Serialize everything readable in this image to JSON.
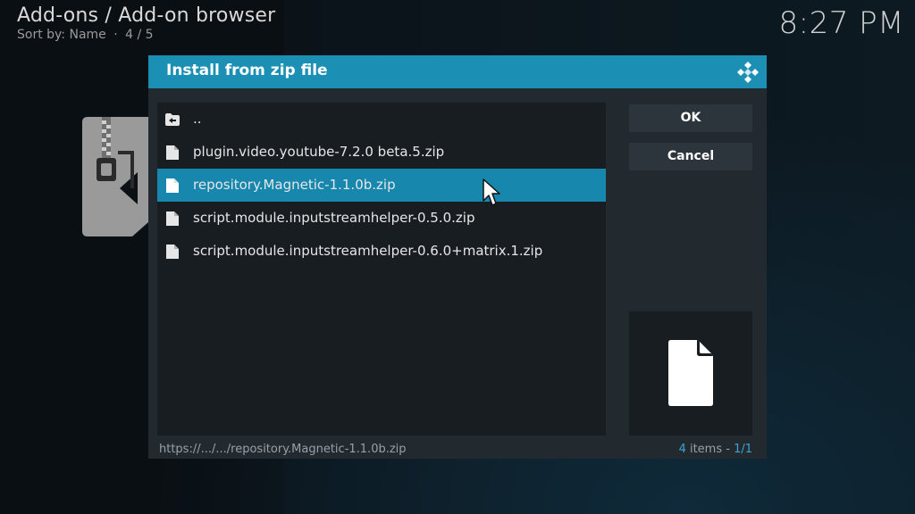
{
  "header": {
    "title": "Add-ons / Add-on browser",
    "sort_label": "Sort by: Name",
    "separator": "·",
    "position": "4 / 5",
    "clock": "8:27 PM"
  },
  "dialog": {
    "title": "Install from zip file",
    "icon": "kodi-logo-icon",
    "files": [
      {
        "label": "..",
        "icon": "folder-up-icon",
        "selected": false
      },
      {
        "label": "plugin.video.youtube-7.2.0 beta.5.zip",
        "icon": "file-icon",
        "selected": false
      },
      {
        "label": "repository.Magnetic-1.1.0b.zip",
        "icon": "file-icon",
        "selected": true
      },
      {
        "label": "script.module.inputstreamhelper-0.5.0.zip",
        "icon": "file-icon",
        "selected": false
      },
      {
        "label": "script.module.inputstreamhelper-0.6.0+matrix.1.zip",
        "icon": "file-icon",
        "selected": false
      }
    ],
    "buttons": {
      "ok": "OK",
      "cancel": "Cancel"
    },
    "preview_icon": "file-icon",
    "footer": {
      "path": "https://.../.../repository.Magnetic-1.1.0b.zip",
      "item_count": "4",
      "items_word": " items - ",
      "page": "1/1"
    }
  },
  "colors": {
    "accent": "#1b8fb4",
    "selected_row": "#1787ad",
    "dialog_bg": "#222a30",
    "list_bg": "#181d22"
  }
}
